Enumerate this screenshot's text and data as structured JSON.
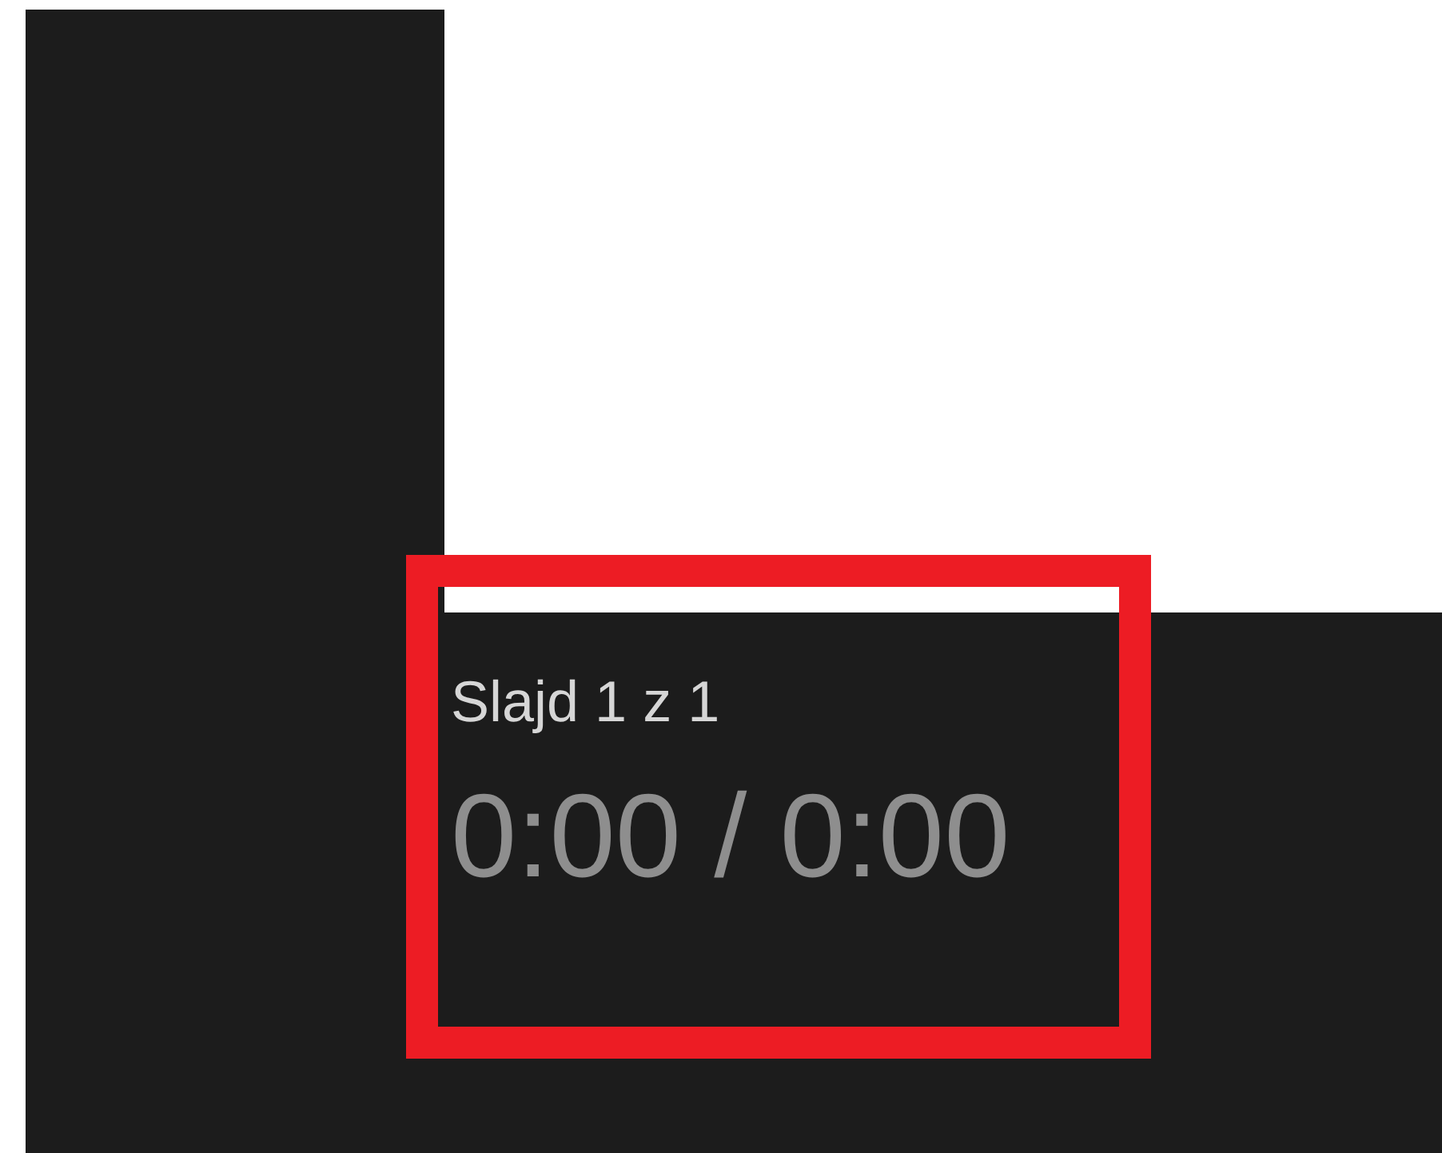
{
  "slide_counter": "Slajd 1 z 1",
  "timer": "0:00 / 0:00"
}
